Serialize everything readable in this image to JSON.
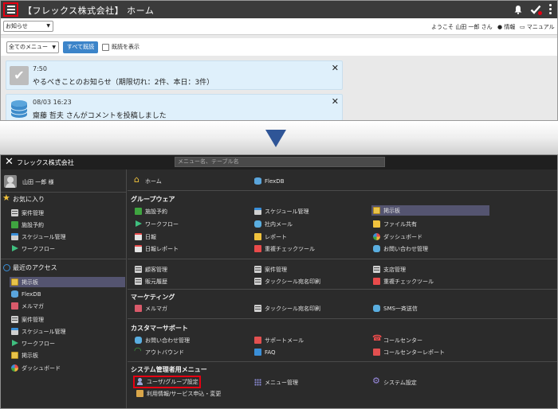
{
  "top": {
    "title": "【フレックス株式会社】 ホーム",
    "notice_select": "お知らせ",
    "welcome": "ようこそ 山田 一郎 さん",
    "info": "情報",
    "manual": "マニュアル",
    "menu_select": "全てのメニュー",
    "read_all": "すべて既読",
    "show_read": "既読を表示",
    "cards": [
      {
        "time": "7:50",
        "message": "やるべきことのお知らせ（期限切れ：2件、本日：3件）"
      },
      {
        "time": "08/03 16:23",
        "message": "齋藤 哲夫 さんがコメントを投稿しました"
      }
    ],
    "colors": {
      "highlight": "#e60012",
      "accent": "#3c84c9",
      "appbar": "#3b3b3b"
    }
  },
  "menu": {
    "company": "フレックス株式会社",
    "search_placeholder": "メニュー名、テーブル名",
    "user_name": "山田 一郎 様",
    "favorites_title": "お気に入り",
    "favorites": [
      "案件管理",
      "施設予約",
      "スケジュール管理",
      "ワークフロー"
    ],
    "recent_title": "最近のアクセス",
    "recent": [
      "掲示板",
      "FlexDB",
      "メルマガ",
      "案件管理",
      "スケジュール管理",
      "ワークフロー",
      "掲示板",
      "ダッシュボード"
    ],
    "home": "ホーム",
    "flexdb": "FlexDB",
    "groupware_title": "グループウェア",
    "groupware": [
      "施設予約",
      "スケジュール管理",
      "掲示板",
      "ワークフロー",
      "社内メール",
      "ファイル共有",
      "日報",
      "レポート",
      "ダッシュボード",
      "日報レポート",
      "重複チェックツール",
      "お問い合わせ管理"
    ],
    "customer": [
      "顧客管理",
      "案件管理",
      "支店管理",
      "販元履歴",
      "タックシール宛名印刷",
      "重複チェックツール"
    ],
    "marketing_title": "マーケティング",
    "marketing": [
      "メルマガ",
      "タックシール宛名印刷",
      "SMS一斉送信"
    ],
    "support_title": "カスタマーサポート",
    "support": [
      "お問い合わせ管理",
      "サポートメール",
      "コールセンター",
      "アウトバウンド",
      "FAQ",
      "コールセンターレポート"
    ],
    "system_title": "システム管理者用メニュー",
    "system": [
      "ユーザ/グループ設定",
      "メニュー管理",
      "システム設定",
      "利用情報/サービス申込・変更"
    ]
  }
}
